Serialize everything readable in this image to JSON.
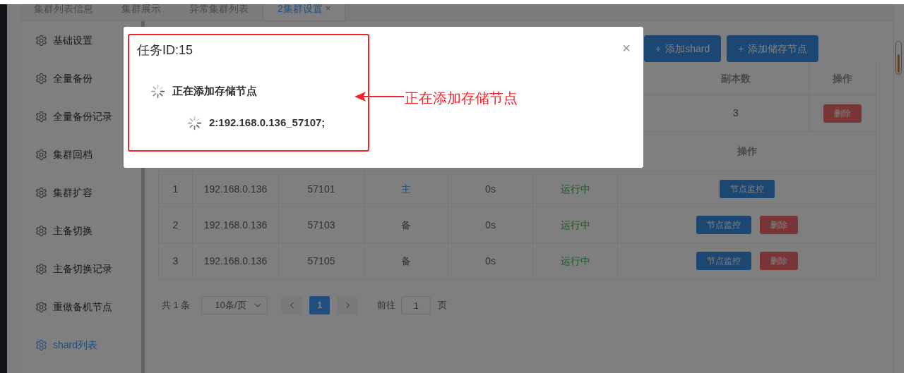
{
  "tabs": [
    {
      "label": "集群列表信息",
      "selected": false
    },
    {
      "label": "集群展示",
      "selected": false
    },
    {
      "label": "异常集群列表",
      "selected": false
    },
    {
      "label": "2集群设置",
      "selected": true,
      "close": "×"
    }
  ],
  "sidebar": {
    "items": [
      {
        "label": "基础设置",
        "selected": false
      },
      {
        "label": "全量备份",
        "selected": false
      },
      {
        "label": "全量备份记录",
        "selected": false
      },
      {
        "label": "集群回档",
        "selected": false
      },
      {
        "label": "集群扩容",
        "selected": false
      },
      {
        "label": "主备切换",
        "selected": false
      },
      {
        "label": "主备切换记录",
        "selected": false
      },
      {
        "label": "重做备机节点",
        "selected": false
      },
      {
        "label": "shard列表",
        "selected": true
      }
    ]
  },
  "toolbar": {
    "buttons": [
      {
        "label": "添加shard",
        "icon": "+"
      },
      {
        "label": "添加储存节点",
        "icon": "+"
      }
    ]
  },
  "shard_table": {
    "columns": [
      "副本数",
      "操作"
    ],
    "rows": [
      {
        "replicas": "3",
        "actions": [
          {
            "label": "删除",
            "kind": "danger"
          }
        ]
      }
    ]
  },
  "node_table": {
    "columns": [
      "操作"
    ],
    "rows": [
      {
        "index": "1",
        "ip": "192.168.0.136",
        "port": "57101",
        "role": "主",
        "primary": true,
        "delay": "0s",
        "status": "运行中",
        "actions": [
          {
            "label": "节点监控",
            "kind": "primary"
          }
        ]
      },
      {
        "index": "2",
        "ip": "192.168.0.136",
        "port": "57103",
        "role": "备",
        "primary": false,
        "delay": "0s",
        "status": "运行中",
        "actions": [
          {
            "label": "节点监控",
            "kind": "primary"
          },
          {
            "label": "删除",
            "kind": "danger"
          }
        ]
      },
      {
        "index": "3",
        "ip": "192.168.0.136",
        "port": "57105",
        "role": "备",
        "primary": false,
        "delay": "0s",
        "status": "运行中",
        "actions": [
          {
            "label": "节点监控",
            "kind": "primary"
          },
          {
            "label": "删除",
            "kind": "danger"
          }
        ]
      }
    ]
  },
  "pagination": {
    "total": "共 1 条",
    "page_size": "10条/页",
    "pages": [
      {
        "label": "1",
        "selected": true
      }
    ],
    "goto_label": "前往",
    "goto_value": "1",
    "page_suffix": "页"
  },
  "modal": {
    "title": "任务ID:15",
    "close": "×",
    "tasks": [
      {
        "text": "正在添加存储节点",
        "children": [
          {
            "text": "2:192.168.0.136_57107;"
          }
        ]
      }
    ]
  },
  "annotation": {
    "text": "正在添加存储节点"
  }
}
